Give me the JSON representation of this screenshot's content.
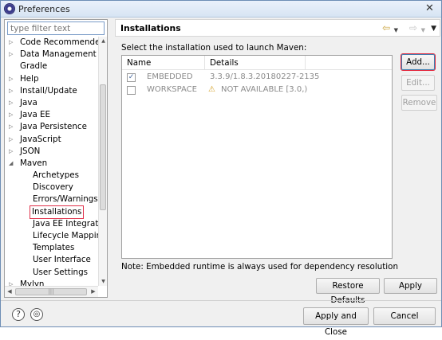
{
  "window": {
    "title": "Preferences",
    "close_glyph": "✕"
  },
  "sidebar": {
    "filter_placeholder": "type filter text",
    "items": [
      {
        "label": "Code Recommenders",
        "arrow": "▷"
      },
      {
        "label": "Data Management",
        "arrow": "▷"
      },
      {
        "label": "Gradle",
        "arrow": ""
      },
      {
        "label": "Help",
        "arrow": "▷"
      },
      {
        "label": "Install/Update",
        "arrow": "▷"
      },
      {
        "label": "Java",
        "arrow": "▷"
      },
      {
        "label": "Java EE",
        "arrow": "▷"
      },
      {
        "label": "Java Persistence",
        "arrow": "▷"
      },
      {
        "label": "JavaScript",
        "arrow": "▷"
      },
      {
        "label": "JSON",
        "arrow": "▷"
      },
      {
        "label": "Maven",
        "arrow": "◢"
      },
      {
        "label": "Archetypes",
        "arrow": ""
      },
      {
        "label": "Discovery",
        "arrow": ""
      },
      {
        "label": "Errors/Warnings",
        "arrow": ""
      },
      {
        "label": "Installations",
        "arrow": ""
      },
      {
        "label": "Java EE Integration",
        "arrow": ""
      },
      {
        "label": "Lifecycle Mapping",
        "arrow": ""
      },
      {
        "label": "Templates",
        "arrow": ""
      },
      {
        "label": "User Interface",
        "arrow": ""
      },
      {
        "label": "User Settings",
        "arrow": ""
      },
      {
        "label": "Mylyn",
        "arrow": "▷"
      }
    ],
    "scroll_up": "▲",
    "scroll_down": "▼",
    "scroll_left": "◀",
    "scroll_right": "▶",
    "hthumb_grip": "|||"
  },
  "page": {
    "title": "Installations",
    "nav": {
      "back": "⇦",
      "forward": "⇨",
      "dropdown": "▼",
      "menu": "▼"
    },
    "subtitle": "Select the installation used to launch Maven:",
    "table": {
      "columns": [
        "Name",
        "Details"
      ],
      "rows": [
        {
          "checked": "✓",
          "name": "EMBEDDED",
          "details": "3.3.9/1.8.3.20180227-2135"
        },
        {
          "checked": "",
          "warn": "⚠",
          "name": "WORKSPACE",
          "details": "NOT AVAILABLE [3.0,)"
        }
      ]
    },
    "buttons": {
      "add": "Add...",
      "edit": "Edit...",
      "remove": "Remove"
    },
    "note": "Note: Embedded runtime is always used for dependency resolution",
    "restore_defaults": "Restore Defaults",
    "apply": "Apply"
  },
  "footer": {
    "help_glyph": "?",
    "import_glyph": "◎",
    "apply_close": "Apply and Close",
    "cancel": "Cancel"
  },
  "colors": {
    "highlight": "#e0304a",
    "focus": "#3c7fb1"
  }
}
